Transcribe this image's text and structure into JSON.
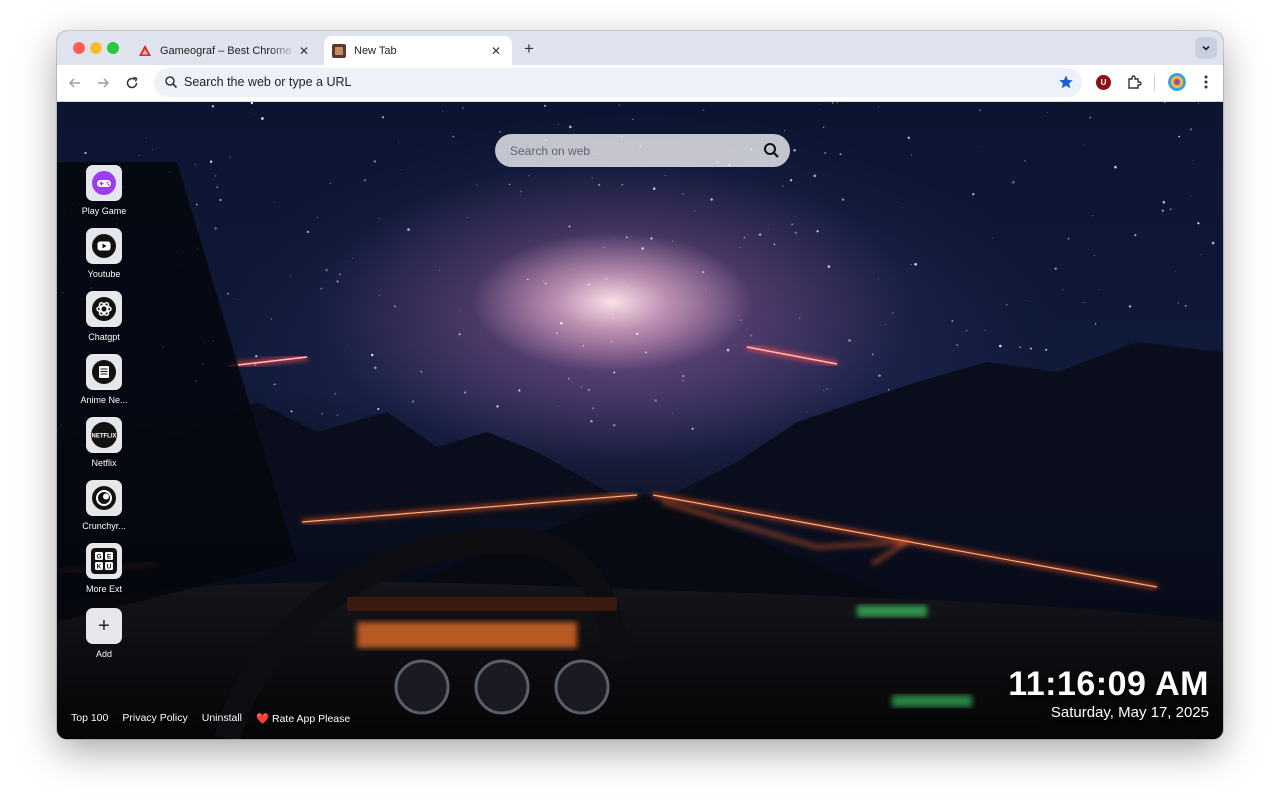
{
  "tabs": [
    {
      "title": "Gameograf – Best Chrome Library",
      "active": false
    },
    {
      "title": "New Tab",
      "active": true
    }
  ],
  "omnibox": {
    "placeholder": "Search the web or type a URL"
  },
  "extensions": {
    "ublock_letter": "U"
  },
  "page_search": {
    "placeholder": "Search on web"
  },
  "shortcuts": [
    {
      "label": "Play Game",
      "icon": "gamepad-icon"
    },
    {
      "label": "Youtube",
      "icon": "youtube-icon"
    },
    {
      "label": "Chatgpt",
      "icon": "chatgpt-icon"
    },
    {
      "label": "Anime Ne...",
      "icon": "news-icon"
    },
    {
      "label": "Netflix",
      "icon": "netflix-icon",
      "icon_text": "NETFLIX"
    },
    {
      "label": "Crunchyr...",
      "icon": "crunchyroll-icon"
    },
    {
      "label": "More Ext",
      "icon": "grid-letters-icon",
      "icon_letters": [
        "G",
        "E",
        "K",
        "U"
      ]
    },
    {
      "label": "Add",
      "icon": "plus-icon",
      "icon_text": "+"
    }
  ],
  "footer": {
    "top100": "Top 100",
    "privacy": "Privacy Policy",
    "uninstall": "Uninstall",
    "rate": "❤️ Rate App Please"
  },
  "clock": {
    "time": "11:16:09 AM",
    "date": "Saturday, May 17, 2025"
  },
  "colors": {
    "tab_strip": "#dfe3ee",
    "star": "#1a5fd0",
    "neon": "#ff5a1f"
  }
}
